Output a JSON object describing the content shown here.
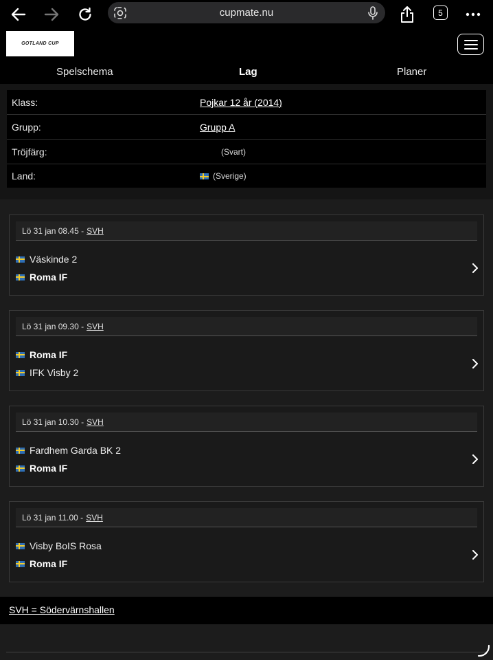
{
  "browser": {
    "url": "cupmate.nu",
    "tab_count": "5"
  },
  "site": {
    "logo_text": "GOTLAND CUP",
    "tabs": [
      {
        "label": "Spelschema"
      },
      {
        "label": "Lag"
      },
      {
        "label": "Planer"
      }
    ]
  },
  "info": {
    "rows": [
      {
        "label": "Klass:",
        "value": "Pojkar 12 år (2014)"
      },
      {
        "label": "Grupp:",
        "value": "Grupp A"
      },
      {
        "label": "Tröjfärg:",
        "value": "(Svart)"
      },
      {
        "label": "Land:",
        "value": "(Sverige)"
      }
    ]
  },
  "matches": [
    {
      "time": "Lö 31 jan 08.45 - ",
      "venue": "SVH",
      "home": "Väskinde 2",
      "away": "Roma IF"
    },
    {
      "time": "Lö 31 jan 09.30 - ",
      "venue": "SVH",
      "home": "Roma IF",
      "away": "IFK Visby 2"
    },
    {
      "time": "Lö 31 jan 10.30 - ",
      "venue": "SVH",
      "home": "Fardhem Garda BK 2",
      "away": "Roma IF"
    },
    {
      "time": "Lö 31 jan 11.00 - ",
      "venue": "SVH",
      "home": "Visby BoIS Rosa",
      "away": "Roma IF"
    }
  ],
  "legend": "SVH = Södervärnshallen",
  "colors": {
    "background": "#1c1c1c",
    "header": "#000000",
    "flag_blue": "#2f6fb5",
    "flag_yellow": "#f4cc2a"
  }
}
